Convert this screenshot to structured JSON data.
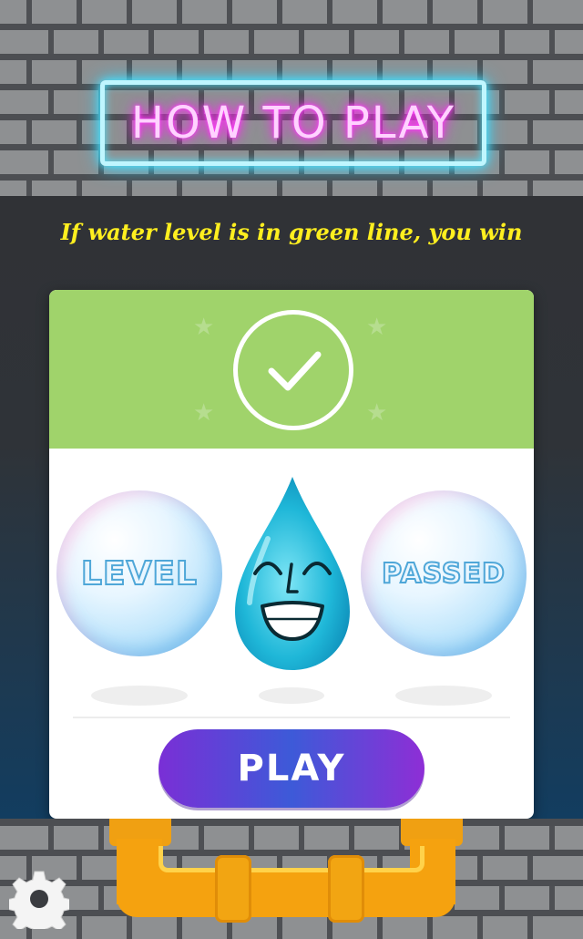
{
  "title": "HOW TO PLAY",
  "hint": "If water level is in green line, you win",
  "result": {
    "left_word": "LEVEL",
    "right_word": "PASSED"
  },
  "play_button": {
    "label": "PLAY"
  },
  "icons": {
    "check": "check-icon",
    "settings": "gear-icon",
    "mascot": "water-drop-icon"
  },
  "colors": {
    "header_green": "#a0d36b",
    "hint_yellow": "#ffef1f",
    "neon_cyan": "#4fe5ff",
    "neon_pink": "#ff2af0",
    "pipe_orange": "#f5a20f",
    "drop_blue": "#1fb7d8"
  }
}
